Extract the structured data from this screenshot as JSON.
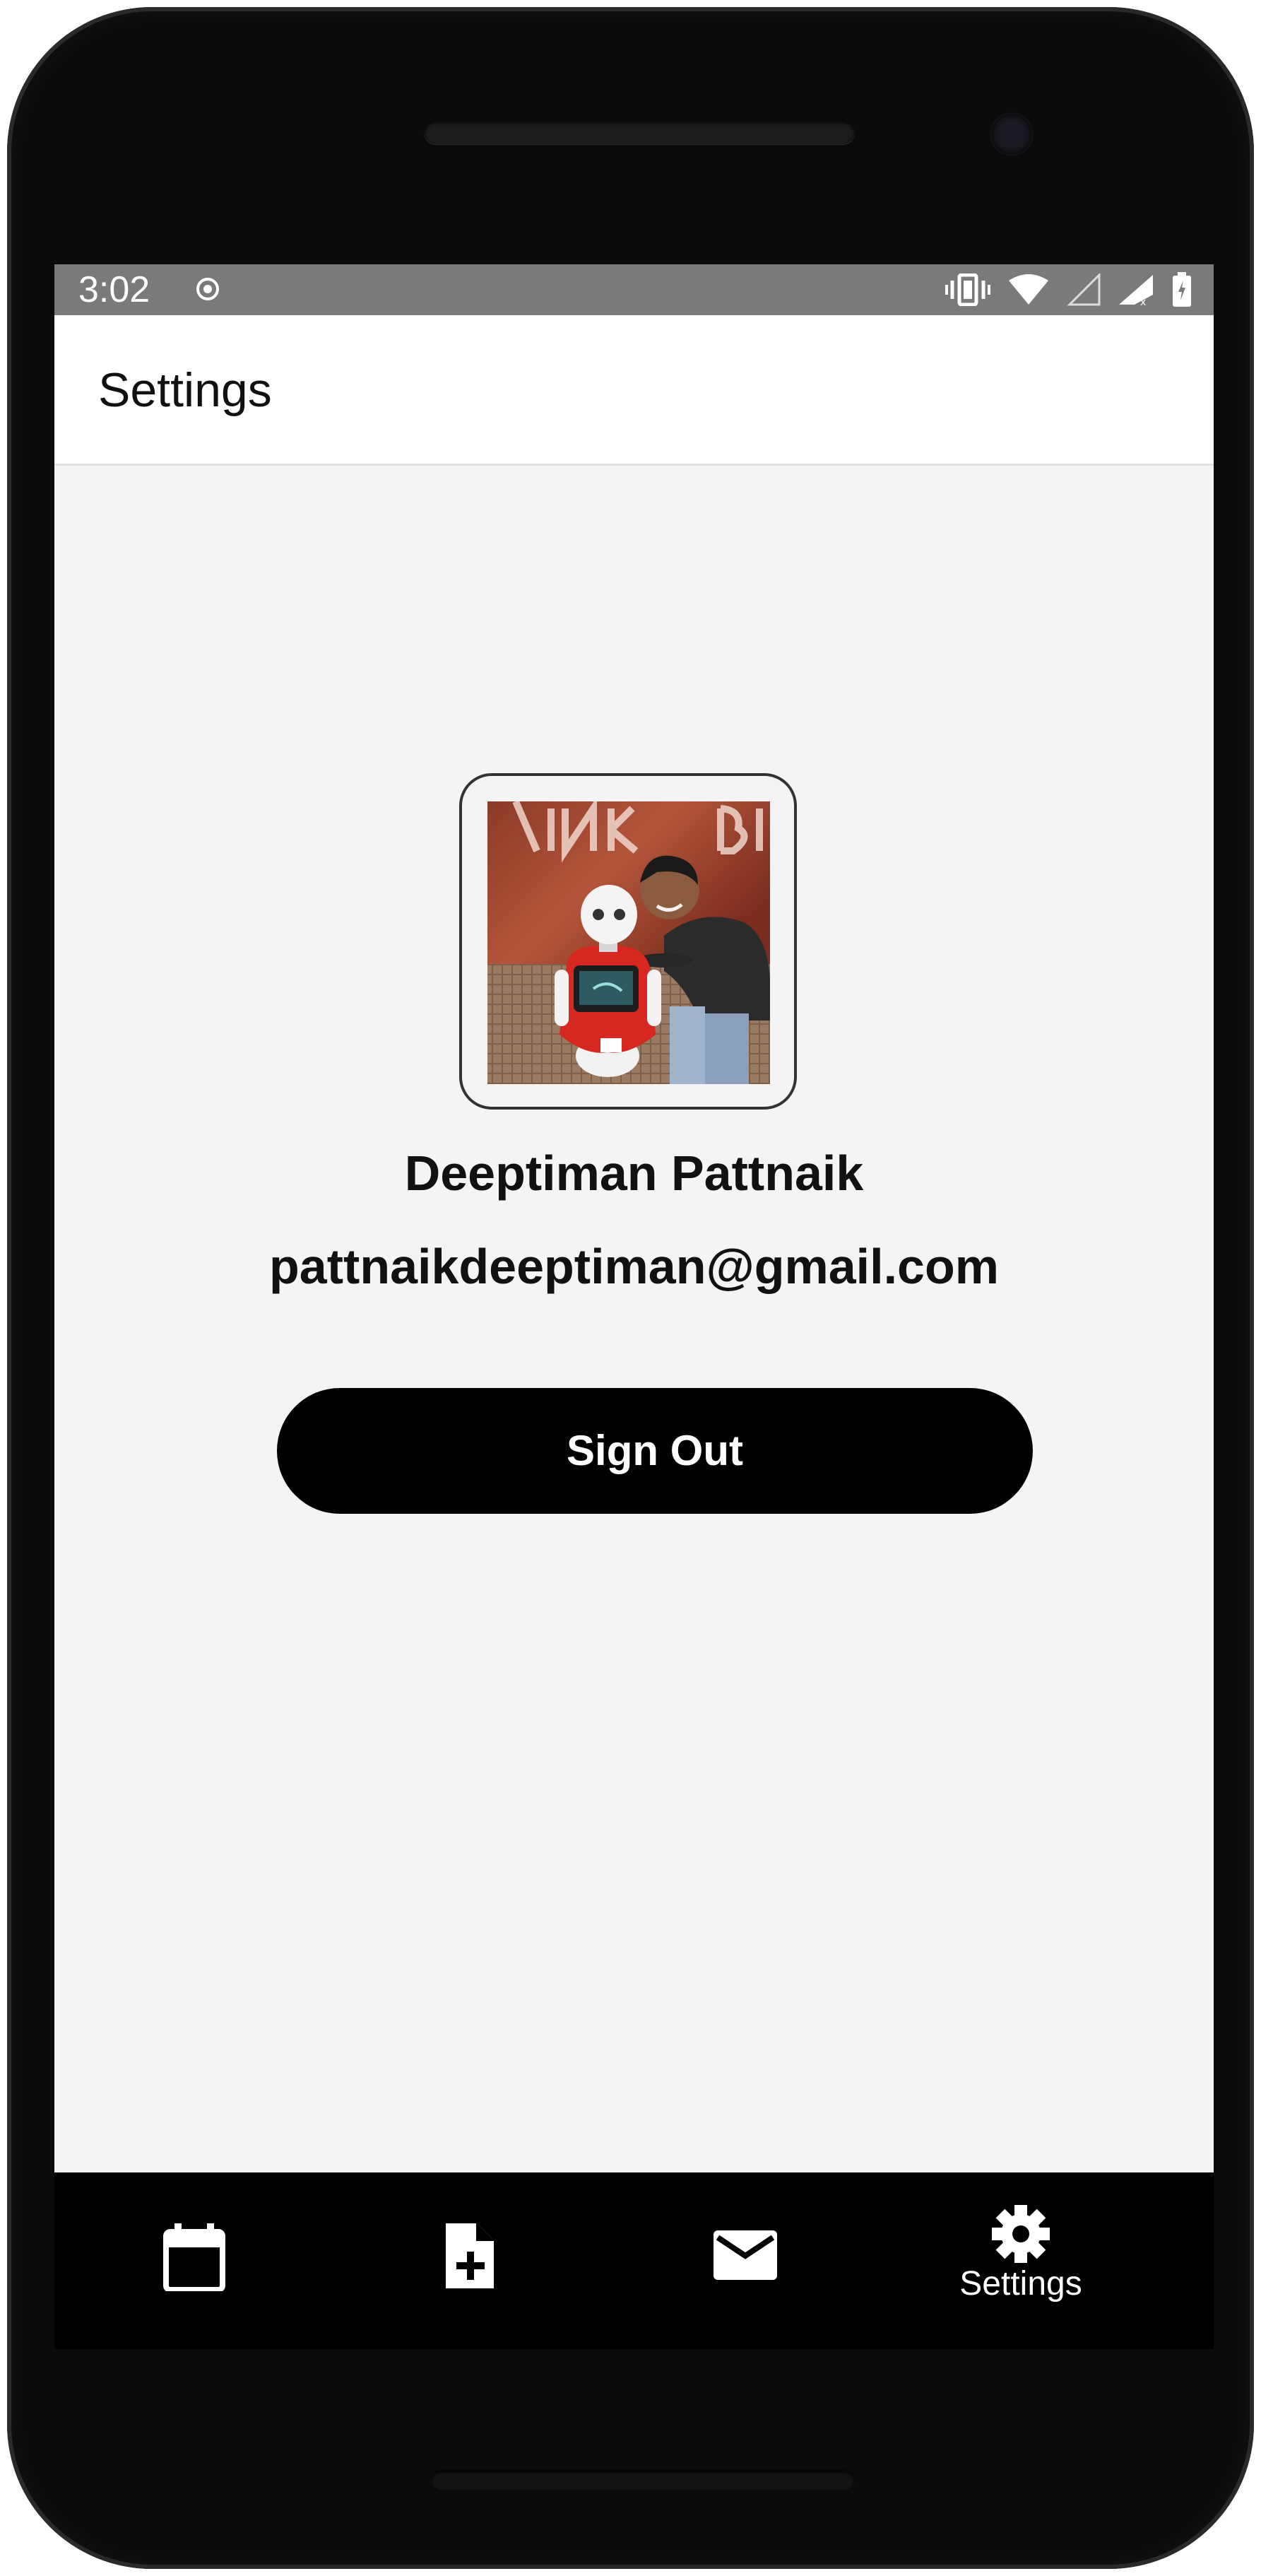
{
  "status_bar": {
    "time": "3:02"
  },
  "app_bar": {
    "title": "Settings"
  },
  "profile": {
    "name": "Deeptiman Pattnaik",
    "email": "pattnaikdeeptiman@gmail.com",
    "photo_description": "avatar-photo"
  },
  "actions": {
    "sign_out_label": "Sign Out"
  },
  "bottom_nav": {
    "items": [
      {
        "icon": "calendar-icon",
        "label": ""
      },
      {
        "icon": "add-note-icon",
        "label": ""
      },
      {
        "icon": "mail-icon",
        "label": ""
      },
      {
        "icon": "gear-icon",
        "label": "Settings"
      }
    ],
    "active_index": 3
  },
  "colors": {
    "screen_background": "#f4f4f4",
    "status_bar": "#7a7a7a",
    "app_bar": "#ffffff",
    "primary_button": "#000000",
    "bottom_nav": "#000000"
  }
}
